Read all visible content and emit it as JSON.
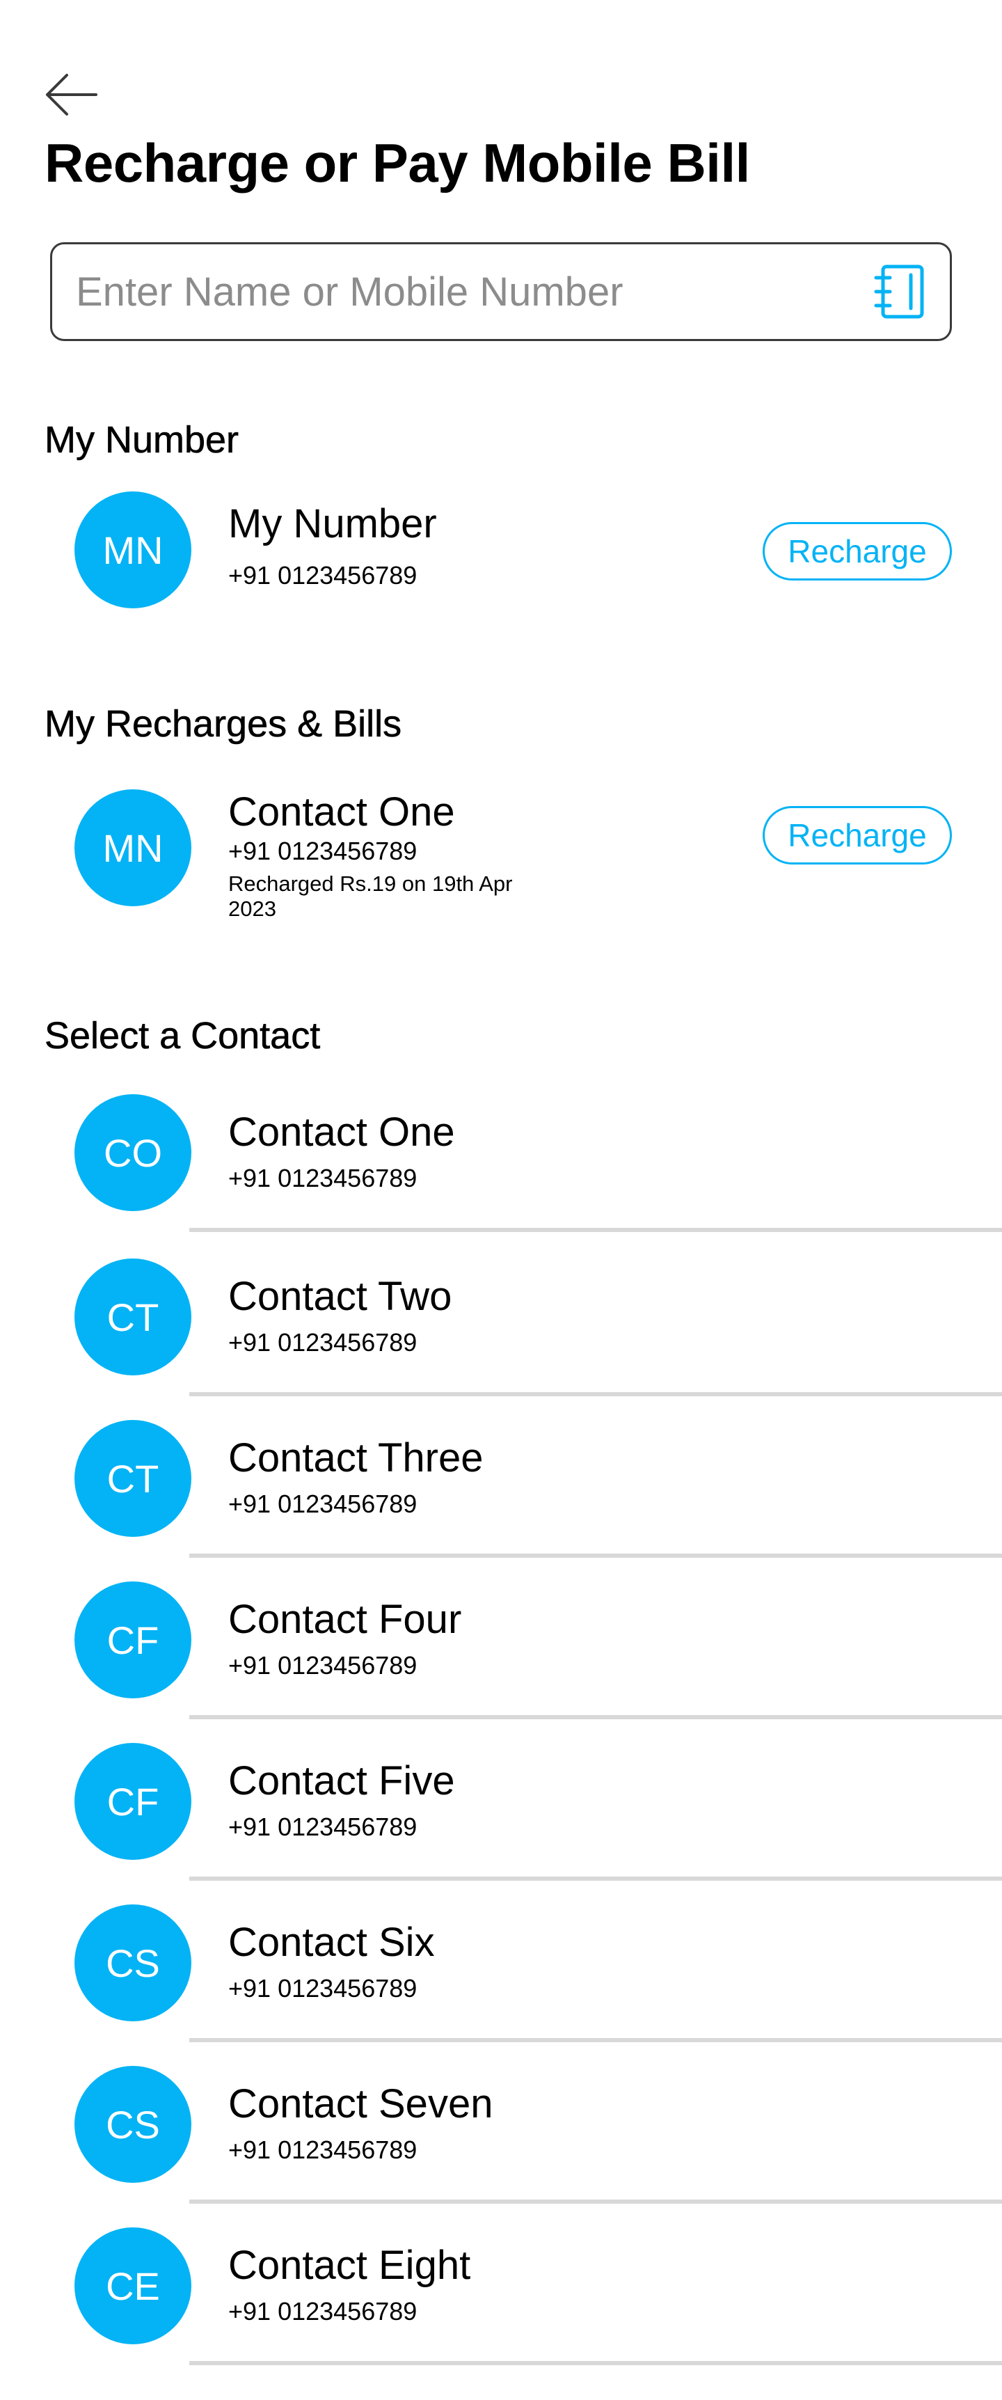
{
  "header": {
    "back_icon": "arrow-left-icon",
    "title": "Recharge or Pay Mobile Bill"
  },
  "search": {
    "placeholder": "Enter Name or Mobile Number",
    "value": "",
    "icon": "contacts-book-icon"
  },
  "accent_color": "#04b3f5",
  "my_number": {
    "section_title": "My Number",
    "initials": "MN",
    "name": "My Number",
    "phone": "+91 0123456789",
    "action_label": "Recharge"
  },
  "recent": {
    "section_title": "My Recharges & Bills",
    "items": [
      {
        "initials": "MN",
        "name": "Contact One",
        "phone": "+91 0123456789",
        "note": "Recharged Rs.19 on 19th Apr 2023",
        "action_label": "Recharge"
      }
    ]
  },
  "contacts": {
    "section_title": "Select a Contact",
    "items": [
      {
        "initials": "CO",
        "name": "Contact One",
        "phone": "+91 0123456789"
      },
      {
        "initials": "CT",
        "name": "Contact Two",
        "phone": "+91 0123456789"
      },
      {
        "initials": "CT",
        "name": "Contact Three",
        "phone": "+91 0123456789"
      },
      {
        "initials": "CF",
        "name": "Contact Four",
        "phone": "+91 0123456789"
      },
      {
        "initials": "CF",
        "name": "Contact Five",
        "phone": "+91 0123456789"
      },
      {
        "initials": "CS",
        "name": "Contact Six",
        "phone": "+91 0123456789"
      },
      {
        "initials": "CS",
        "name": "Contact Seven",
        "phone": "+91 0123456789"
      },
      {
        "initials": "CE",
        "name": "Contact Eight",
        "phone": "+91 0123456789"
      }
    ]
  }
}
